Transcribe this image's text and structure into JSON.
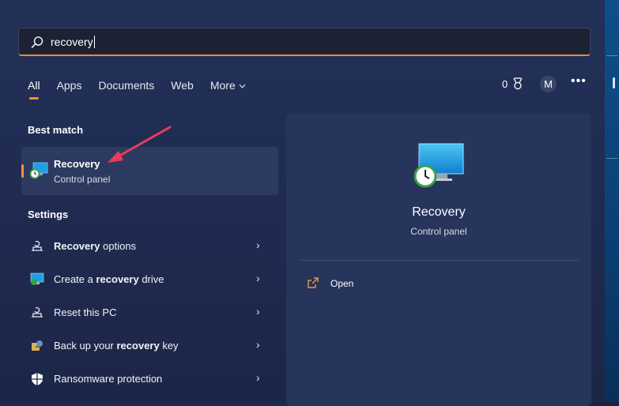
{
  "search": {
    "value": "recovery"
  },
  "tabs": [
    {
      "label": "All"
    },
    {
      "label": "Apps"
    },
    {
      "label": "Documents"
    },
    {
      "label": "Web"
    },
    {
      "label": "More"
    }
  ],
  "header": {
    "points": "0",
    "avatar_initial": "M",
    "more_dots": "•••"
  },
  "best_match": {
    "title": "Best match",
    "item": {
      "name": "Recovery",
      "type": "Control panel"
    }
  },
  "settings": {
    "title": "Settings",
    "items": [
      {
        "pre": "",
        "bold": "Recovery",
        "post": " options"
      },
      {
        "pre": "Create a ",
        "bold": "recovery",
        "post": " drive"
      },
      {
        "pre": "Reset this PC",
        "bold": "",
        "post": ""
      },
      {
        "pre": "Back up your ",
        "bold": "recovery",
        "post": " key"
      },
      {
        "pre": "Ransomware protection",
        "bold": "",
        "post": ""
      }
    ]
  },
  "detail": {
    "name": "Recovery",
    "type": "Control panel",
    "actions": [
      {
        "label": "Open"
      }
    ]
  },
  "colors": {
    "accent": "#f0923f",
    "annotation": "#e83c5a"
  }
}
